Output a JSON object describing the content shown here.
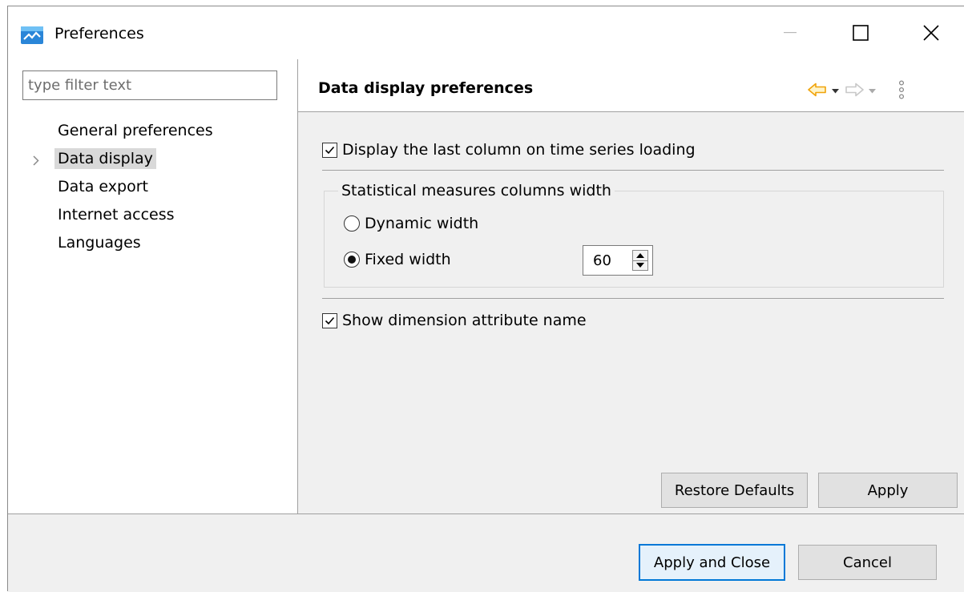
{
  "window": {
    "title": "Preferences",
    "icon": "preferences-app-icon",
    "controls": [
      "minimize-icon",
      "maximize-icon",
      "close-icon"
    ]
  },
  "sidebar": {
    "filter_placeholder": "type filter text",
    "filter_value": "",
    "items": [
      {
        "label": "General preferences",
        "selected": false,
        "expandable": false
      },
      {
        "label": "Data display",
        "selected": true,
        "expandable": true
      },
      {
        "label": "Data export",
        "selected": false,
        "expandable": false
      },
      {
        "label": "Internet access",
        "selected": false,
        "expandable": false
      },
      {
        "label": "Languages",
        "selected": false,
        "expandable": false
      }
    ]
  },
  "page": {
    "title": "Data display preferences",
    "nav_icons": [
      "back-arrow-icon",
      "dropdown-icon",
      "forward-arrow-icon",
      "dropdown-icon",
      "view-menu-icon"
    ],
    "accent_color": "#f0a30a",
    "display_last_column": {
      "label": "Display the last column on time series loading",
      "checked": true
    },
    "column_width_group": {
      "title": "Statistical measures columns width",
      "dynamic": {
        "label": "Dynamic width",
        "selected": false
      },
      "fixed": {
        "label": "Fixed width",
        "selected": true,
        "value": "60"
      }
    },
    "show_dimension_attribute": {
      "label": "Show dimension attribute name",
      "checked": true
    },
    "restore_defaults_label": "Restore Defaults",
    "apply_label": "Apply"
  },
  "footer": {
    "apply_close_label": "Apply and Close",
    "cancel_label": "Cancel",
    "focus_color": "#0078d7"
  }
}
